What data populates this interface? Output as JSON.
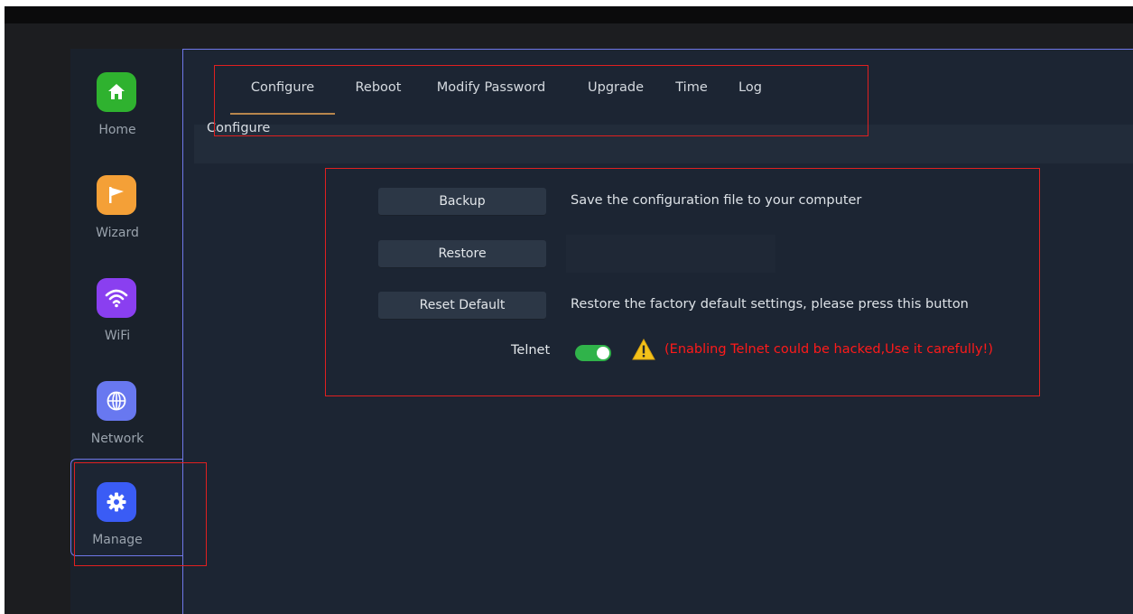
{
  "sidebar": {
    "items": [
      {
        "label": "Home",
        "icon": "home-icon",
        "color": "#2fb22f"
      },
      {
        "label": "Wizard",
        "icon": "flag-icon",
        "color": "#f4a037"
      },
      {
        "label": "WiFi",
        "icon": "wifi-icon",
        "color": "#8a3ff0"
      },
      {
        "label": "Network",
        "icon": "globe-icon",
        "color": "#6878f0"
      },
      {
        "label": "Manage",
        "icon": "gear-icon",
        "color": "#3a5cf5"
      }
    ],
    "active": "Manage"
  },
  "tabs": [
    {
      "label": "Configure",
      "active": true
    },
    {
      "label": "Reboot"
    },
    {
      "label": "Modify Password"
    },
    {
      "label": "Upgrade"
    },
    {
      "label": "Time"
    },
    {
      "label": "Log"
    }
  ],
  "section_title": "Configure",
  "config": {
    "backup_label": "Backup",
    "backup_desc": "Save the configuration file to your computer",
    "restore_label": "Restore",
    "restore_file_value": "",
    "reset_label": "Reset Default",
    "reset_desc": "Restore the factory default settings, please press this button",
    "telnet_label": "Telnet",
    "telnet_enabled": true,
    "telnet_warning": "(Enabling Telnet could be hacked,Use it carefully!)"
  },
  "colors": {
    "accent_tab_underline": "#b8864c",
    "highlight_box": "#e02020",
    "warning_text": "#ff1a1a",
    "toggle_on": "#30b34a"
  }
}
